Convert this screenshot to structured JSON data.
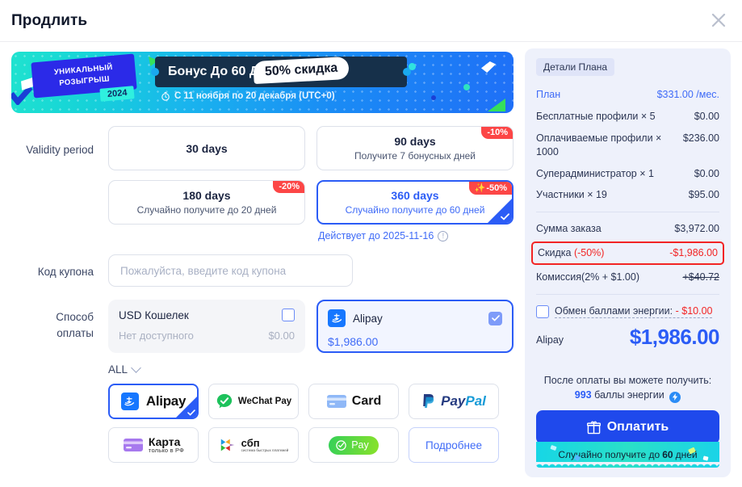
{
  "header": {
    "title": "Продлить",
    "close_icon": "close-icon"
  },
  "banner": {
    "ticket_line1": "УНИКАЛЬНЫЙ",
    "ticket_line2": "РОЗЫГРЫШ",
    "year": "2024",
    "bonus_text": "Бонус До 60 Дней +",
    "discount_pill": "50% скидка",
    "period": "С 11 ноября по 20 декабря (UTC+0)",
    "timer_icon": "stopwatch-icon"
  },
  "validity": {
    "label": "Validity period",
    "options": [
      {
        "title": "30 days",
        "sub": "",
        "badge": "",
        "selected": false
      },
      {
        "title": "90 days",
        "sub": "Получите 7 бонусных дней",
        "badge": "-10%",
        "selected": false
      },
      {
        "title": "180 days",
        "sub": "Случайно получите до 20 дней",
        "badge": "-20%",
        "selected": false
      },
      {
        "title": "360 days",
        "sub": "Случайно получите до 60 дней",
        "badge": "-50%",
        "selected": true
      }
    ],
    "valid_until": "Действует до 2025-11-16",
    "info_icon": "info-icon"
  },
  "coupon": {
    "label": "Код купона",
    "value": "",
    "placeholder": "Пожалуйста, введите код купона"
  },
  "payment": {
    "label_line1": "Способ",
    "label_line2": "оплаты",
    "wallet": {
      "name": "USD Кошелек",
      "status": "Нет доступного",
      "amount": "$0.00",
      "selected": false
    },
    "alipay": {
      "name": "Alipay",
      "amount": "$1,986.00",
      "selected": true,
      "icon": "alipay-icon"
    },
    "filter_label": "ALL",
    "filter_icon": "chevron-down-icon",
    "methods": [
      {
        "name": "Alipay",
        "icon": "alipay-icon",
        "selected": true
      },
      {
        "name": "WeChat Pay",
        "icon": "wechat-pay-icon",
        "selected": false
      },
      {
        "name": "Card",
        "icon": "credit-card-icon",
        "selected": false
      },
      {
        "name": "PayPal",
        "icon": "paypal-icon",
        "selected": false
      },
      {
        "name": "Карта",
        "sub": "только в РФ",
        "icon": "card-ru-icon",
        "selected": false
      },
      {
        "name": "сбп",
        "sub": "система быстрых платежей",
        "icon": "sbp-icon",
        "selected": false
      },
      {
        "name": "Pay",
        "icon": "mir-pay-icon",
        "selected": false
      },
      {
        "name": "Подробнее",
        "icon": "more-link",
        "selected": false
      }
    ]
  },
  "summary": {
    "tag": "Детали Плана",
    "lines": [
      {
        "key": "План",
        "value": "$331.00 /мес.",
        "style": "blue"
      },
      {
        "key": "Бесплатные профили × 5",
        "value": "$0.00",
        "style": "normal"
      },
      {
        "key": "Оплачиваемые профили × 1000",
        "value": "$236.00",
        "style": "normal"
      },
      {
        "key": "Суперадминистратор × 1",
        "value": "$0.00",
        "style": "normal"
      },
      {
        "key": "Участники × 19",
        "value": "$95.00",
        "style": "normal"
      }
    ],
    "order_total": {
      "key": "Сумма заказа",
      "value": "$3,972.00"
    },
    "discount": {
      "key": "Скидка",
      "pct": "(-50%)",
      "value": "-$1,986.00"
    },
    "commission": {
      "key": "Комиссия(2% + $1.00)",
      "value": "+$40.72"
    },
    "energy": {
      "label": "Обмен баллами энергии:",
      "value": "- $10.00",
      "checked": false
    },
    "total": {
      "method": "Alipay",
      "amount": "$1,986.00"
    },
    "after_pay_line1": "После оплаты вы можете получить:",
    "after_pay_points": "993",
    "after_pay_line2": "баллы энергии",
    "energy_icon": "energy-bolt-icon",
    "pay_button": "Оплатить",
    "pay_button_icon": "gift-icon",
    "strip_pre": "Случайно получите до",
    "strip_days": "60",
    "strip_post": "дней"
  },
  "colors": {
    "accent": "#2b5cf6",
    "danger": "#f22424",
    "panel_bg": "#eef1fb",
    "banner_cyan": "#1fe3cf",
    "banner_blue": "#1f6ff7"
  }
}
